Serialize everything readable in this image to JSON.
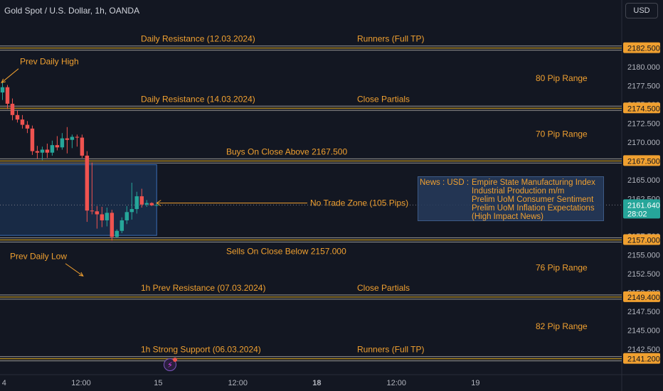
{
  "header": {
    "title": "Gold Spot / U.S. Dollar, 1h, OANDA",
    "currency_button": "USD"
  },
  "colors": {
    "background": "#131722",
    "bull": "#26a69a",
    "bear": "#ef5350",
    "annotation": "#f0a030",
    "level_line": "#8a8a8a",
    "zone_fill": "#1d3a63",
    "zone_border": "#3a6db5"
  },
  "chart_data": {
    "type": "candlestick",
    "ylim": [
      2140.6,
      2183.6
    ],
    "y_ticks": [
      "2180.000",
      "2177.500",
      "2175.000",
      "2172.500",
      "2170.000",
      "2165.000",
      "2162.500",
      "2157.500",
      "2155.000",
      "2152.500",
      "2150.000",
      "2147.500",
      "2145.000",
      "2142.500"
    ],
    "x_ticks": [
      {
        "label": "4",
        "bar": -0.1,
        "bold": false
      },
      {
        "label": "12:00",
        "bar": 15.8,
        "bold": false
      },
      {
        "label": "15",
        "bar": 31.3,
        "bold": false
      },
      {
        "label": "12:00",
        "bar": 47.3,
        "bold": false
      },
      {
        "label": "18",
        "bar": 63.2,
        "bold": true
      },
      {
        "label": "12:00",
        "bar": 79.2,
        "bold": false
      },
      {
        "label": "19",
        "bar": 95.1,
        "bold": false
      }
    ],
    "x_bar_range": [
      -0.5,
      124.5
    ],
    "candles": [
      {
        "i": 0,
        "o": 2176.6,
        "h": 2178.1,
        "l": 2175.6,
        "c": 2177.3
      },
      {
        "i": 1,
        "o": 2177.3,
        "h": 2177.6,
        "l": 2174.4,
        "c": 2175.1
      },
      {
        "i": 2,
        "o": 2175.1,
        "h": 2175.8,
        "l": 2172.9,
        "c": 2173.6
      },
      {
        "i": 3,
        "o": 2173.6,
        "h": 2174.2,
        "l": 2172.6,
        "c": 2173.0
      },
      {
        "i": 4,
        "o": 2173.0,
        "h": 2173.6,
        "l": 2171.8,
        "c": 2172.3
      },
      {
        "i": 5,
        "o": 2172.3,
        "h": 2172.8,
        "l": 2171.2,
        "c": 2171.8
      },
      {
        "i": 6,
        "o": 2171.8,
        "h": 2172.2,
        "l": 2168.3,
        "c": 2168.8
      },
      {
        "i": 7,
        "o": 2168.8,
        "h": 2169.5,
        "l": 2167.8,
        "c": 2168.6
      },
      {
        "i": 8,
        "o": 2168.6,
        "h": 2169.4,
        "l": 2167.6,
        "c": 2169.0
      },
      {
        "i": 9,
        "o": 2169.0,
        "h": 2169.8,
        "l": 2167.9,
        "c": 2168.6
      },
      {
        "i": 10,
        "o": 2168.6,
        "h": 2170.2,
        "l": 2168.2,
        "c": 2169.6
      },
      {
        "i": 11,
        "o": 2169.6,
        "h": 2170.8,
        "l": 2168.9,
        "c": 2169.3
      },
      {
        "i": 12,
        "o": 2169.3,
        "h": 2171.2,
        "l": 2169.0,
        "c": 2170.5
      },
      {
        "i": 13,
        "o": 2170.5,
        "h": 2172.0,
        "l": 2168.5,
        "c": 2170.3
      },
      {
        "i": 14,
        "o": 2170.3,
        "h": 2171.0,
        "l": 2169.2,
        "c": 2170.7
      },
      {
        "i": 15,
        "o": 2170.7,
        "h": 2171.0,
        "l": 2169.4,
        "c": 2170.6
      },
      {
        "i": 16,
        "o": 2170.6,
        "h": 2171.0,
        "l": 2167.9,
        "c": 2168.2
      },
      {
        "i": 17,
        "o": 2168.2,
        "h": 2168.8,
        "l": 2159.4,
        "c": 2160.9
      },
      {
        "i": 18,
        "o": 2160.9,
        "h": 2167.3,
        "l": 2160.4,
        "c": 2160.8
      },
      {
        "i": 19,
        "o": 2160.8,
        "h": 2161.5,
        "l": 2158.5,
        "c": 2160.4
      },
      {
        "i": 20,
        "o": 2160.4,
        "h": 2161.4,
        "l": 2158.7,
        "c": 2159.6
      },
      {
        "i": 21,
        "o": 2159.6,
        "h": 2161.3,
        "l": 2158.8,
        "c": 2160.6
      },
      {
        "i": 22,
        "o": 2160.6,
        "h": 2161.0,
        "l": 2156.9,
        "c": 2157.4
      },
      {
        "i": 23,
        "o": 2157.4,
        "h": 2158.4,
        "l": 2157.3,
        "c": 2158.2
      },
      {
        "i": 24,
        "o": 2158.2,
        "h": 2160.0,
        "l": 2157.9,
        "c": 2159.6
      },
      {
        "i": 25,
        "o": 2159.6,
        "h": 2161.5,
        "l": 2159.1,
        "c": 2160.7
      },
      {
        "i": 26,
        "o": 2160.7,
        "h": 2164.6,
        "l": 2159.7,
        "c": 2161.1
      },
      {
        "i": 27,
        "o": 2161.1,
        "h": 2163.4,
        "l": 2160.5,
        "c": 2162.8
      },
      {
        "i": 28,
        "o": 2162.8,
        "h": 2163.8,
        "l": 2161.3,
        "c": 2161.7
      },
      {
        "i": 29,
        "o": 2161.7,
        "h": 2162.3,
        "l": 2161.4,
        "c": 2161.9
      },
      {
        "i": 30,
        "o": 2161.9,
        "h": 2162.0,
        "l": 2161.5,
        "c": 2161.6
      },
      {
        "i": 31,
        "o": 2161.6,
        "h": 2161.8,
        "l": 2161.5,
        "c": 2161.64
      }
    ],
    "levels": [
      {
        "price": 2182.5,
        "badge": "2182.500",
        "left_label": "Daily Resistance (12.03.2024)",
        "right_label": "Runners (Full TP)"
      },
      {
        "price": 2174.5,
        "badge": "2174.500",
        "left_label": "Daily Resistance (14.03.2024)",
        "right_label": "Close Partials"
      },
      {
        "price": 2167.5,
        "badge": "2167.500",
        "left_label": "Buys On Close Above 2167.500",
        "right_label": ""
      },
      {
        "price": 2157.0,
        "badge": "2157.000",
        "left_label": "Sells On Close Below 2157.000",
        "right_label": ""
      },
      {
        "price": 2149.4,
        "badge": "2149.400",
        "left_label": "1h Prev Resistance (07.03.2024)",
        "right_label": "Close Partials"
      },
      {
        "price": 2141.2,
        "badge": "2141.200",
        "left_label": "1h Strong Support (06.03.2024)",
        "right_label": "Runners (Full TP)"
      }
    ],
    "pip_ranges": [
      {
        "label": "80 Pip Range",
        "price": 2178.5
      },
      {
        "label": "70 Pip Range",
        "price": 2171.1
      },
      {
        "label": "76 Pip Range",
        "price": 2153.3
      },
      {
        "label": "82 Pip Range",
        "price": 2145.5
      }
    ],
    "no_trade_zone": {
      "top": 2167.0,
      "bottom": 2157.6,
      "bar_from": 0,
      "bar_to": 31,
      "label": "No Trade Zone (105 Pips)",
      "label_price": 2161.9
    },
    "annotations": [
      {
        "label": "Prev Daily High",
        "text_price": 2180.7,
        "text_bar": 3.5,
        "arrow_to_bar": -0.2,
        "arrow_to_price": 2177.9
      },
      {
        "label": "Prev Daily Low",
        "text_price": 2154.8,
        "text_bar": 1.5,
        "arrow_to_bar": 16.2,
        "arrow_to_price": 2152.2
      }
    ],
    "current_price": {
      "value": "2161.640",
      "countdown": "28:02",
      "price": 2161.64
    }
  },
  "news": {
    "prefix": "News : USD :",
    "items": [
      "Empire State Manufacturing Index",
      "Industrial Production m/m",
      "Prelim UoM Consumer Sentiment",
      "Prelim UoM Inflation Expectations",
      "(High Impact News)"
    ]
  },
  "icons": {
    "event_marker": "flash-icon"
  }
}
